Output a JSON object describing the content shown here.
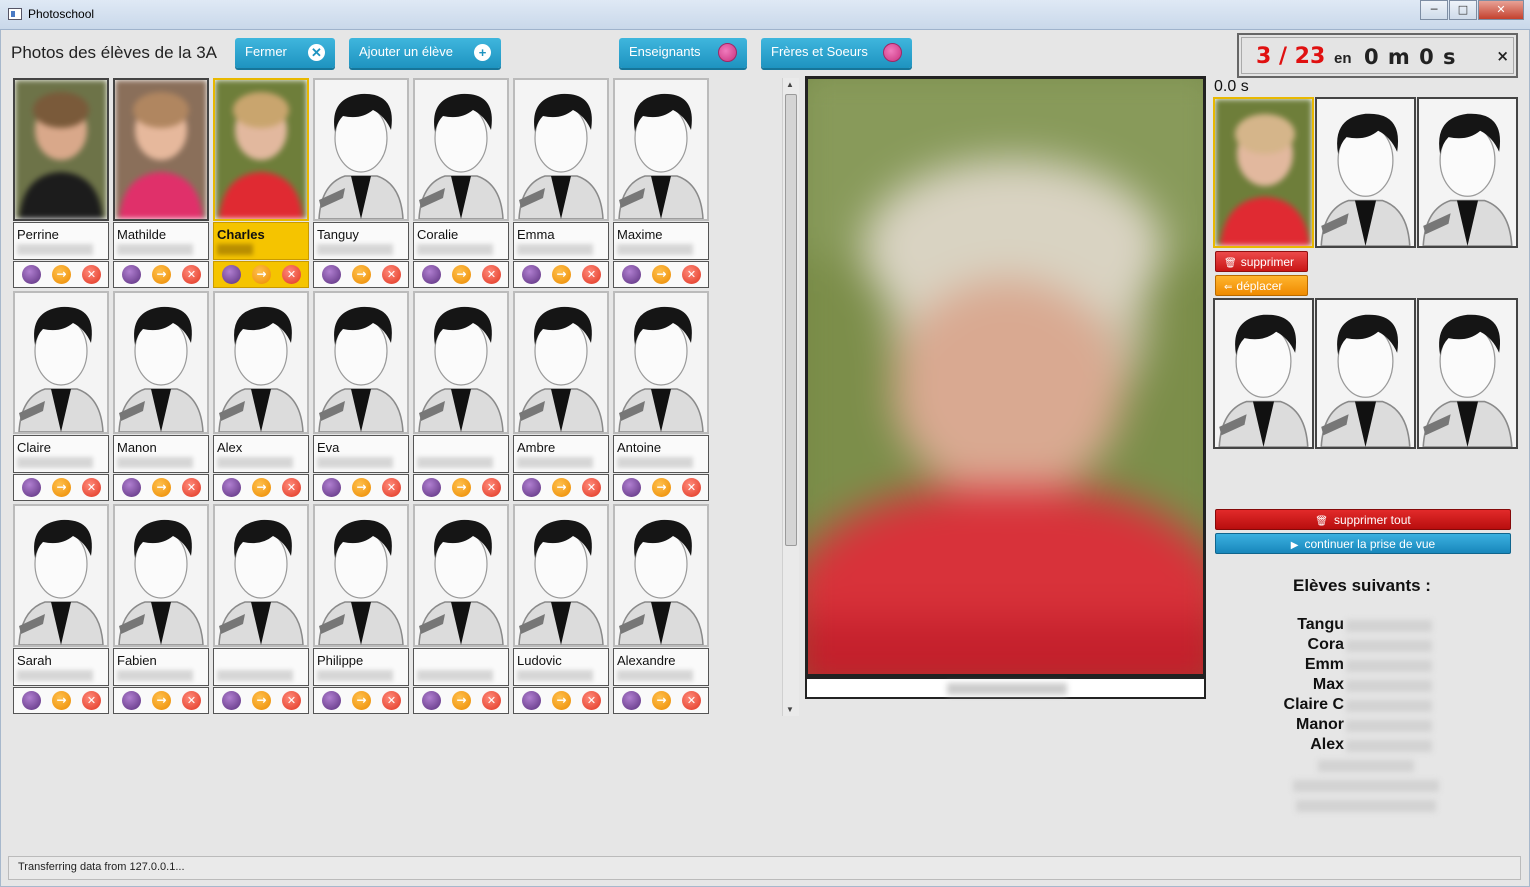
{
  "window": {
    "title": "Photoschool",
    "minimize": "─",
    "maximize": "□",
    "close": "✕"
  },
  "header": {
    "class_title": "Photos des élèves de la 3A",
    "close_label": "Fermer",
    "add_student_label": "Ajouter un élève",
    "teachers_label": "Enseignants",
    "siblings_label": "Frères et Soeurs"
  },
  "students": [
    {
      "name": "Perrine",
      "has_photo": true,
      "tint": "dark"
    },
    {
      "name": "Mathilde",
      "has_photo": true,
      "tint": "pink"
    },
    {
      "name": "Charles",
      "has_photo": true,
      "tint": "red",
      "selected": true
    },
    {
      "name": "Tanguy",
      "has_photo": false
    },
    {
      "name": "Coralie",
      "has_photo": false
    },
    {
      "name": "Emma",
      "has_photo": false
    },
    {
      "name": "Maxime",
      "has_photo": false
    },
    {
      "name": "Claire",
      "has_photo": false
    },
    {
      "name": "Manon",
      "has_photo": false
    },
    {
      "name": "Alex",
      "has_photo": false
    },
    {
      "name": "Eva",
      "has_photo": false
    },
    {
      "name": "",
      "has_photo": false
    },
    {
      "name": "Ambre",
      "has_photo": false
    },
    {
      "name": "Antoine",
      "has_photo": false
    },
    {
      "name": "Sarah",
      "has_photo": false
    },
    {
      "name": "Fabien",
      "has_photo": false
    },
    {
      "name": "",
      "has_photo": false
    },
    {
      "name": "Philippe",
      "has_photo": false
    },
    {
      "name": "",
      "has_photo": false
    },
    {
      "name": "Ludovic",
      "has_photo": false
    },
    {
      "name": "Alexandre",
      "has_photo": false
    }
  ],
  "counter": {
    "taken": "3 / 23",
    "en": "en",
    "time": "0 m 0 s",
    "close": "×"
  },
  "elapsed": "0.0 s",
  "shots": {
    "delete_label": "supprimer",
    "move_label": "déplacer",
    "delete_all_label": "supprimer tout",
    "continue_label": "continuer la prise de vue"
  },
  "next_students": {
    "title": "Elèves suivants :",
    "items": [
      "Tangu",
      "Cora",
      "Emm",
      "Max",
      "Claire C",
      "Manor",
      "Alex"
    ]
  },
  "status": "Transferring data from 127.0.0.1..."
}
